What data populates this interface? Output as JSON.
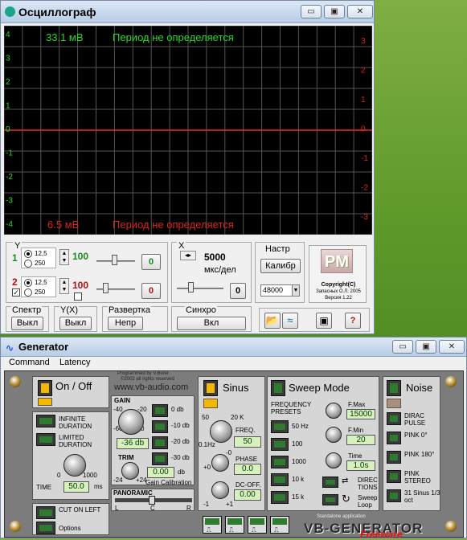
{
  "oscilloscope": {
    "title": "Осциллограф",
    "window_buttons": {
      "minimize": "▭",
      "maximize": "▣",
      "close": "✕"
    },
    "screen": {
      "top_amplitude": "33.1 мВ",
      "top_period": "Период не определяется",
      "bottom_amplitude": "6.5 мВ",
      "bottom_period": "Период не определяется",
      "left_scale": [
        "4",
        "3",
        "2",
        "1",
        "0",
        "-1",
        "-2",
        "-3",
        "-4"
      ],
      "right_scale": [
        "3",
        "2",
        "1",
        "0",
        "-1",
        "-2",
        "-3"
      ],
      "colors": {
        "trace": "#e03030",
        "grid": "#555555",
        "left_text": "#22dd22",
        "right_text": "#dd2222"
      }
    },
    "y_group": {
      "label": "Y",
      "ch1": {
        "num": "1",
        "radio_a": "12,5",
        "radio_b": "250",
        "value": "100",
        "button": "0"
      },
      "ch2": {
        "num": "2",
        "radio_a": "12,5",
        "radio_b": "250",
        "value": "100",
        "button": "0"
      }
    },
    "x_group": {
      "label": "X",
      "value": "5000",
      "unit": "мкс/дел",
      "button": "0"
    },
    "settings": {
      "label": "Настр",
      "calibrate": "Калибр",
      "sample_rate": "48000"
    },
    "logo": {
      "text": "PM",
      "copyright": "Copyright(C)",
      "author": "Запасных О.Л. 2005",
      "version": "Версия 1.22"
    },
    "groups": [
      {
        "label": "Спектр",
        "button": "Выкл"
      },
      {
        "label": "Y(X)",
        "button": "Выкл"
      },
      {
        "label": "Развертка",
        "button": "Непр"
      },
      {
        "label": "Синхро",
        "button": "Вкл"
      }
    ],
    "help_button": "?"
  },
  "generator": {
    "title": "Generator",
    "menu": [
      "Command",
      "Latency"
    ],
    "on_off": "On / Off",
    "programmed_by": "Programmed by V.Burel",
    "copyright": "©2002 all rights reserved",
    "website": "www.vb-audio.com",
    "infinite_duration": "INFINITE DURATION",
    "limited_duration": "LIMITED DURATION",
    "time_scale": {
      "min": "0",
      "max": "1000",
      "unit": "ms"
    },
    "time_label": "TIME",
    "time_value": "50.0",
    "cut_on_left": "CUT ON LEFT",
    "options": "Options",
    "gain": {
      "label": "GAIN",
      "marks": [
        "-40",
        "-20",
        "-60",
        "-80",
        "0"
      ],
      "value": "-36 db"
    },
    "gain_buttons": [
      "0 db",
      "-10 db",
      "-20 db",
      "-30 db"
    ],
    "trim": {
      "label": "TRIM",
      "min": "-24",
      "max": "+24",
      "value": "0.00",
      "unit": "db",
      "calibration": "Gain Calibration"
    },
    "panoramic": {
      "label": "PANORAMIC",
      "left": "L",
      "center": "C",
      "right": "R"
    },
    "sinus": "Sinus",
    "freq": {
      "label": "FREQ.",
      "value": "50",
      "marks": [
        "50",
        "20 K",
        "0.1Hz"
      ]
    },
    "phase": {
      "label": "PHASE",
      "value": "0.0",
      "marks": [
        "-0",
        "+0"
      ]
    },
    "dc_off": {
      "label": "DC-OFF.",
      "value": "0.00",
      "marks": [
        "-1",
        "+1"
      ]
    },
    "sweep_mode": "Sweep Mode",
    "freq_presets": {
      "label": "FREQUENCY PRESETS",
      "items": [
        "50 Hz",
        "100",
        "1000",
        "10 k",
        "15 k"
      ]
    },
    "fmax": {
      "label": "F.Max",
      "value": "15000"
    },
    "fmin": {
      "label": "F.Min",
      "value": "20"
    },
    "sweep_time": {
      "label": "Time",
      "value": "1.0s"
    },
    "directions": "DIREC TIONS",
    "sweep_loop": "Sweep Loop",
    "noise": "Noise",
    "noise_buttons": [
      "DIRAC PULSE",
      "PINK 0°",
      "PINK 180°",
      "PINK STEREO",
      "31 Sinus 1/3 oct"
    ],
    "standalone": "Standalone application",
    "brand": "VB-GENERATOR",
    "freeware": "Freeware"
  }
}
